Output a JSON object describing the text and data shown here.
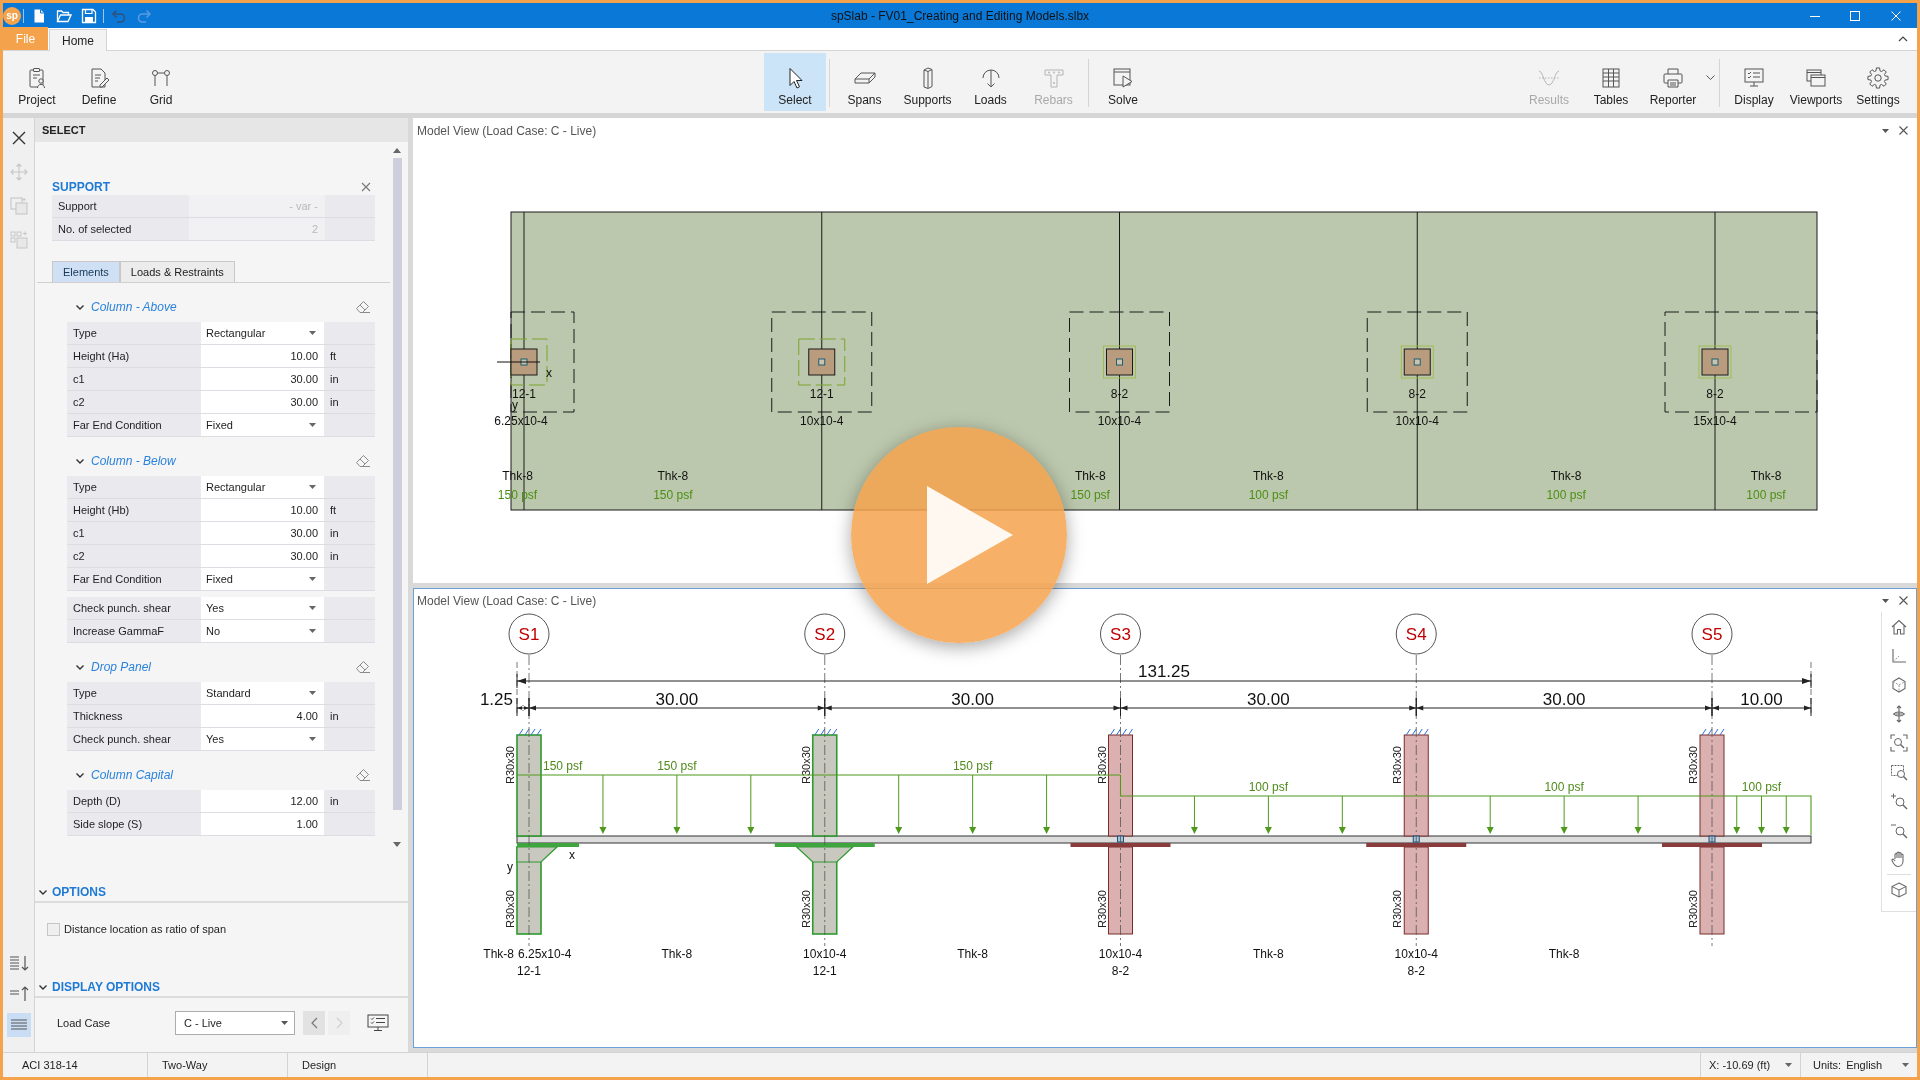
{
  "window": {
    "logo": "sp",
    "title": "spSlab - FV01_Creating and Editing Models.slbx"
  },
  "quick_access": [
    {
      "disabled": false
    },
    {
      "disabled": false
    },
    {
      "disabled": false
    },
    {
      "disabled": false
    },
    {
      "disabled": true
    }
  ],
  "menu_tabs": [
    {
      "label": "File",
      "kind": "backstage",
      "selected": false
    },
    {
      "label": "Home",
      "kind": "tab",
      "selected": true
    }
  ],
  "ribbon": {
    "groups": [
      [
        {
          "label": "Project",
          "selected": false,
          "disabled": false,
          "dropdown": false
        },
        {
          "label": "Define",
          "selected": false,
          "disabled": false,
          "dropdown": false
        },
        {
          "label": "Grid",
          "selected": false,
          "disabled": false,
          "dropdown": false
        }
      ],
      [
        {
          "label": "Select",
          "selected": true,
          "disabled": false,
          "dropdown": false
        }
      ],
      [
        {
          "label": "Spans",
          "selected": false,
          "disabled": false,
          "dropdown": false
        },
        {
          "label": "Supports",
          "selected": false,
          "disabled": false,
          "dropdown": false
        },
        {
          "label": "Loads",
          "selected": false,
          "disabled": false,
          "dropdown": false
        },
        {
          "label": "Rebars",
          "selected": false,
          "disabled": true,
          "dropdown": false
        }
      ],
      [
        {
          "label": "Solve",
          "selected": false,
          "disabled": false,
          "dropdown": false
        }
      ],
      [
        {
          "label": "Results",
          "selected": false,
          "disabled": true,
          "dropdown": false
        },
        {
          "label": "Tables",
          "selected": false,
          "disabled": false,
          "dropdown": false
        },
        {
          "label": "Reporter",
          "selected": false,
          "disabled": false,
          "dropdown": true
        }
      ],
      [
        {
          "label": "Display",
          "selected": false,
          "disabled": false,
          "dropdown": false
        },
        {
          "label": "Viewports",
          "selected": false,
          "disabled": false,
          "dropdown": false
        },
        {
          "label": "Settings",
          "selected": false,
          "disabled": false,
          "dropdown": false
        }
      ]
    ]
  },
  "tools": [
    {
      "disabled": false
    },
    {
      "disabled": true
    },
    {
      "disabled": true
    },
    {
      "disabled": true
    }
  ],
  "panel": {
    "title": "SELECT",
    "support": {
      "title": "SUPPORT",
      "rows": [
        {
          "label": "Support",
          "value": "- var -",
          "disabled": true
        },
        {
          "label": "No. of selected",
          "value": "2",
          "disabled": true
        }
      ]
    },
    "tabs": [
      {
        "label": "Elements",
        "selected": true
      },
      {
        "label": "Loads & Restraints",
        "selected": false
      }
    ],
    "sections": [
      {
        "title": "Column - Above",
        "expanded": true,
        "tables": [
          [
            {
              "label": "Type",
              "value": "Rectangular",
              "kind": "dropdown"
            },
            {
              "label": "Height (Ha)",
              "value": "10.00",
              "unit": "ft",
              "kind": "number"
            },
            {
              "label": "c1",
              "value": "30.00",
              "unit": "in",
              "kind": "number"
            },
            {
              "label": "c2",
              "value": "30.00",
              "unit": "in",
              "kind": "number"
            },
            {
              "label": "Far End Condition",
              "value": "Fixed",
              "kind": "dropdown"
            }
          ]
        ]
      },
      {
        "title": "Column - Below",
        "expanded": true,
        "tables": [
          [
            {
              "label": "Type",
              "value": "Rectangular",
              "kind": "dropdown"
            },
            {
              "label": "Height (Hb)",
              "value": "10.00",
              "unit": "ft",
              "kind": "number"
            },
            {
              "label": "c1",
              "value": "30.00",
              "unit": "in",
              "kind": "number"
            },
            {
              "label": "c2",
              "value": "30.00",
              "unit": "in",
              "kind": "number"
            },
            {
              "label": "Far End Condition",
              "value": "Fixed",
              "kind": "dropdown"
            }
          ],
          [
            {
              "label": "Check punch. shear",
              "value": "Yes",
              "kind": "dropdown"
            },
            {
              "label": "Increase GammaF",
              "value": "No",
              "kind": "dropdown"
            }
          ]
        ]
      },
      {
        "title": "Drop Panel",
        "expanded": true,
        "tables": [
          [
            {
              "label": "Type",
              "value": "Standard",
              "kind": "dropdown"
            },
            {
              "label": "Thickness",
              "value": "4.00",
              "unit": "in",
              "kind": "number"
            },
            {
              "label": "Check punch. shear",
              "value": "Yes",
              "kind": "dropdown"
            }
          ]
        ]
      },
      {
        "title": "Column Capital",
        "expanded": true,
        "tables": [
          [
            {
              "label": "Depth (D)",
              "value": "12.00",
              "unit": "in",
              "kind": "number"
            },
            {
              "label": "Side slope (S)",
              "value": "1.00",
              "kind": "number"
            }
          ]
        ]
      }
    ]
  },
  "options": {
    "title": "OPTIONS",
    "expanded": true,
    "checkbox": {
      "label": "Distance location as ratio of span",
      "checked": false
    }
  },
  "display_options": {
    "title": "DISPLAY OPTIONS",
    "expanded": true,
    "load_case": {
      "label": "Load Case",
      "value": "C - Live"
    },
    "navigation": [
      {
        "disabled": false
      },
      {
        "disabled": true
      }
    ]
  },
  "panel_modes": [
    {
      "selected": false
    },
    {
      "selected": false
    },
    {
      "selected": true
    }
  ],
  "views": [
    {
      "title": "Model View (Load Case: C - Live)",
      "active": false,
      "kind": "plan",
      "supports": [
        {
          "column": "12-1",
          "drop_panel": "6.25x10-4",
          "selected": true
        },
        {
          "column": "12-1",
          "drop_panel": "10x10-4",
          "selected": true
        },
        {
          "column": "8-2",
          "drop_panel": "10x10-4",
          "selected": false
        },
        {
          "column": "8-2",
          "drop_panel": "10x10-4",
          "selected": false
        },
        {
          "column": "8-2",
          "drop_panel": "15x10-4",
          "selected": false
        }
      ],
      "panels": [
        {
          "thickness": "Thk-8",
          "load": "150 psf"
        },
        {
          "thickness": "Thk-8",
          "load": "150 psf"
        },
        {
          "thickness": "Thk-8",
          "load": "150 psf"
        },
        {
          "thickness": "Thk-8",
          "load": "100 psf"
        },
        {
          "thickness": "Thk-8",
          "load": "100 psf"
        },
        {
          "thickness": "Thk-8",
          "load": "100 psf"
        }
      ],
      "axis_labels": {
        "x": "x",
        "y": "y"
      }
    },
    {
      "title": "Model View (Load Case: C - Live)",
      "active": true,
      "kind": "elevation",
      "supports": [
        {
          "name": "S1",
          "column_above": "R30x30",
          "column_below": "R30x30",
          "drop_panel": "6.25x10-4",
          "column": "12-1",
          "selected": true
        },
        {
          "name": "S2",
          "column_above": "R30x30",
          "column_below": "R30x30",
          "drop_panel": "10x10-4",
          "column": "12-1",
          "selected": true
        },
        {
          "name": "S3",
          "column_above": "R30x30",
          "column_below": "R30x30",
          "drop_panel": "10x10-4",
          "column": "8-2",
          "selected": false
        },
        {
          "name": "S4",
          "column_above": "R30x30",
          "column_below": "R30x30",
          "drop_panel": "10x10-4",
          "column": "8-2",
          "selected": false
        },
        {
          "name": "S5",
          "column_above": "R30x30",
          "column_below": "R30x30",
          "selected": false
        }
      ],
      "overall_dimension": "131.25",
      "span_dimensions": [
        "1.25",
        "30.00",
        "30.00",
        "30.00",
        "30.00",
        "10.00"
      ],
      "loads": [
        {
          "labels": [
            "150 psf",
            "150 psf",
            "150 psf"
          ]
        },
        {
          "labels": [
            "100 psf",
            "100 psf",
            "100 psf"
          ]
        }
      ],
      "span_labels": [
        "Thk-8",
        "Thk-8",
        "Thk-8",
        "Thk-8",
        "Thk-8"
      ],
      "axis_labels": {
        "x": "x",
        "y": "y"
      }
    }
  ],
  "status_bar": {
    "items": [
      "ACI 318-14",
      "Two-Way",
      "Design"
    ],
    "coordinate": "X: -10.69 (ft)",
    "units": {
      "label": "Units:",
      "value": "English"
    }
  }
}
